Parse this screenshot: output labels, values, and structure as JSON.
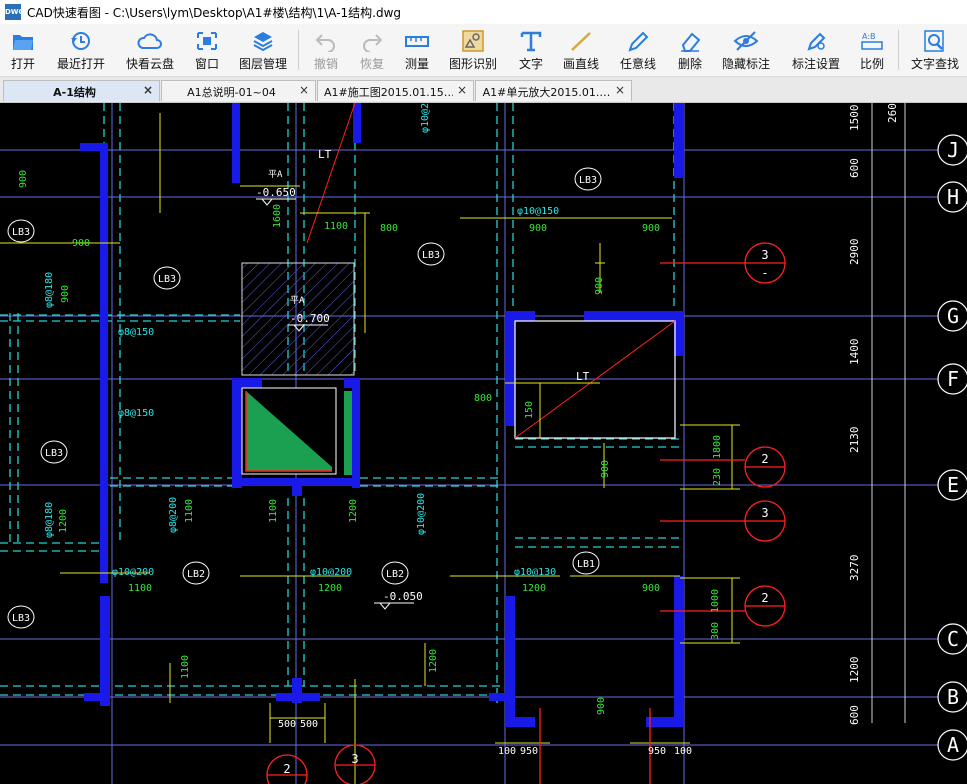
{
  "window": {
    "title": "CAD快速看图 - C:\\Users\\lym\\Desktop\\A1#楼\\结构\\1\\A-1结构.dwg",
    "icon_text": "DWG"
  },
  "toolbar": {
    "open": "打开",
    "recent": "最近打开",
    "cloud": "快看云盘",
    "window": "窗口",
    "layers": "图层管理",
    "undo": "撤销",
    "redo": "恢复",
    "measure": "测量",
    "recognize": "图形识别",
    "text": "文字",
    "line": "画直线",
    "freeline": "任意线",
    "delete": "删除",
    "hide_marks": "隐藏标注",
    "mark_settings": "标注设置",
    "scale": "比例",
    "find_text": "文字查找"
  },
  "tabs": [
    {
      "label": "A-1结构",
      "active": true
    },
    {
      "label": "A1总说明-01~04",
      "active": false
    },
    {
      "label": "A1#施工图2015.01.15…",
      "active": false
    },
    {
      "label": "A1#单元放大2015.01.…",
      "active": false
    }
  ],
  "tab_close_glyph": "×",
  "drawing": {
    "grid_labels": [
      "J",
      "H",
      "G",
      "F",
      "E",
      "C",
      "B",
      "A"
    ],
    "side_dims": [
      "1500",
      "600",
      "2900",
      "1400",
      "2130",
      "3270",
      "1200",
      "600"
    ],
    "top_dim": "260",
    "section_marks": [
      "3",
      "2",
      "3",
      "2",
      "2",
      "3"
    ],
    "section_sub": "-",
    "slabs": [
      "LB3",
      "LB3",
      "LB3",
      "LB3",
      "LB3",
      "LB2",
      "LB2",
      "LB1",
      "LB3"
    ],
    "stair": [
      "LT",
      "LT"
    ],
    "levels": [
      "-0.650",
      "-0.700",
      "-0.050"
    ],
    "level_marks": [
      "平A",
      "平A"
    ],
    "rebar": [
      "φ10@150",
      "φ8@150",
      "φ8@150",
      "φ10@200",
      "φ10@200",
      "φ10@130",
      "φ8@180",
      "φ8@180",
      "φ8@200",
      "φ10@200",
      "φ10@200"
    ],
    "dims": [
      "900",
      "900",
      "900",
      "900",
      "1100",
      "800",
      "1600",
      "900",
      "900",
      "1100",
      "1200",
      "1200",
      "1100",
      "1100",
      "1200",
      "1200",
      "800",
      "150",
      "1800",
      "230",
      "1000",
      "300",
      "900",
      "900",
      "500",
      "500",
      "100",
      "950",
      "950",
      "100",
      "1100",
      "1200",
      "900"
    ]
  },
  "colors": {
    "background": "#000000",
    "wall": "#1e1ee6",
    "grid_line": "#7a7aee",
    "dim_yellow": "#e6e620",
    "rebar_cyan": "#28e6e6",
    "text_green": "#37e637",
    "section_red": "#ff2020",
    "white": "#ffffff"
  }
}
